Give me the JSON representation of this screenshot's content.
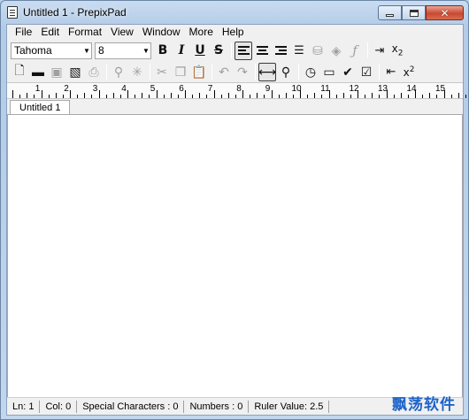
{
  "window": {
    "title": "Untitled 1 - PrepixPad"
  },
  "menu": [
    "File",
    "Edit",
    "Format",
    "View",
    "Window",
    "More",
    "Help"
  ],
  "format_toolbar": {
    "font_name": "Tahoma",
    "font_size": "8",
    "subscript_label": "x",
    "subscript_mark": "2"
  },
  "insert_toolbar": {
    "superscript_label": "x",
    "superscript_mark": "2"
  },
  "ruler": {
    "numbers": [
      "1",
      "2",
      "3",
      "4",
      "5",
      "6",
      "7",
      "8",
      "9",
      "10",
      "11",
      "12",
      "13",
      "14",
      "15"
    ]
  },
  "tabs": [
    {
      "label": "Untitled 1"
    }
  ],
  "status": {
    "line": "Ln: 1",
    "col": "Col: 0",
    "special": "Special Characters : 0",
    "numbers": "Numbers : 0",
    "ruler_value": "Ruler Value: 2.5"
  },
  "watermark": "飘荡软件",
  "colors": {
    "titlebar": "#b3cbe6",
    "close": "#c84a32",
    "watermark": "#1e63c9"
  }
}
